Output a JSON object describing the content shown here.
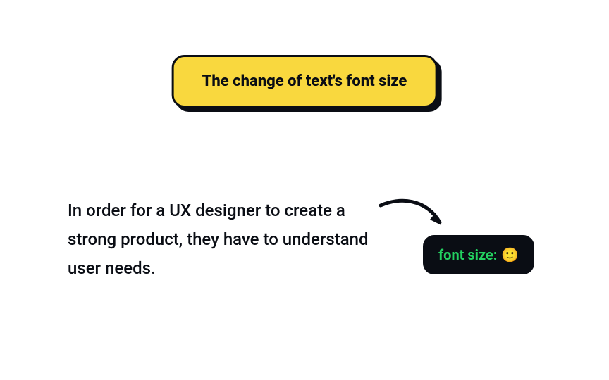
{
  "title": "The change of text's font size",
  "body": "In order for a UX designer to create a strong product, they have to understand user needs.",
  "callout": {
    "label": "font size:",
    "emoji": "🙂"
  }
}
